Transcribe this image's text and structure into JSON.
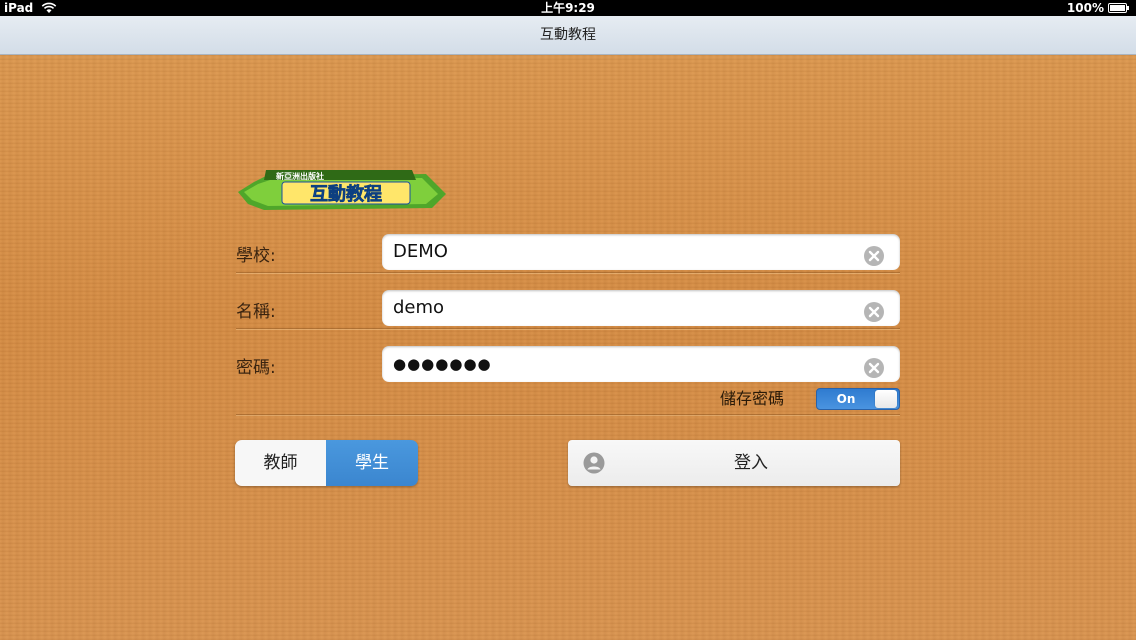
{
  "status_bar": {
    "device": "iPad",
    "time": "上午9:29",
    "battery": "100%"
  },
  "nav": {
    "title": "互動教程"
  },
  "logo": {
    "publisher": "新亞洲出版社",
    "name": "互動教程",
    "colors": {
      "banner": "#6cc23a",
      "text_fill": "#1b6fd0"
    }
  },
  "form": {
    "school": {
      "label": "學校:",
      "value": "DEMO"
    },
    "name": {
      "label": "名稱:",
      "value": "demo"
    },
    "password": {
      "label": "密碼:",
      "value": "●●●●●●●"
    },
    "save_password": {
      "label": "儲存密碼",
      "toggle_text": "On",
      "state": "on"
    }
  },
  "role": {
    "options": [
      "教師",
      "學生"
    ],
    "selected": "學生"
  },
  "login": {
    "label": "登入",
    "icon": "user-icon"
  },
  "colors": {
    "accent_blue": "#3b86cf",
    "wood": "#d8924a"
  }
}
